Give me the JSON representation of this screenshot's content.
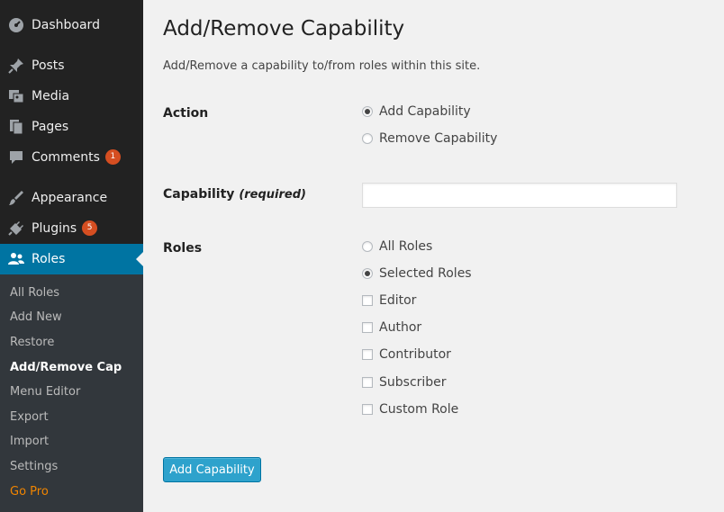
{
  "sidebar": {
    "items": [
      {
        "label": "Dashboard",
        "icon": "dashboard-icon"
      },
      {
        "label": "Posts",
        "icon": "pin-icon"
      },
      {
        "label": "Media",
        "icon": "media-icon"
      },
      {
        "label": "Pages",
        "icon": "pages-icon"
      },
      {
        "label": "Comments",
        "icon": "comment-icon",
        "badge": "1"
      },
      {
        "label": "Appearance",
        "icon": "brush-icon"
      },
      {
        "label": "Plugins",
        "icon": "plug-icon",
        "badge": "5"
      },
      {
        "label": "Roles",
        "icon": "users-icon",
        "active": true
      }
    ],
    "submenu": [
      {
        "label": "All Roles"
      },
      {
        "label": "Add New"
      },
      {
        "label": "Restore"
      },
      {
        "label": "Add/Remove Cap",
        "current": true
      },
      {
        "label": "Menu Editor"
      },
      {
        "label": "Export"
      },
      {
        "label": "Import"
      },
      {
        "label": "Settings"
      },
      {
        "label": "Go Pro",
        "highlight_color": "#f18500"
      }
    ]
  },
  "main": {
    "title": "Add/Remove Capability",
    "description": "Add/Remove a capability to/from roles within this site.",
    "action": {
      "label": "Action",
      "options": [
        {
          "label": "Add Capability",
          "selected": true
        },
        {
          "label": "Remove Capability",
          "selected": false
        }
      ]
    },
    "capability": {
      "label": "Capability",
      "required_note": "(required)",
      "value": "",
      "placeholder": ""
    },
    "roles": {
      "label": "Roles",
      "scope_options": [
        {
          "label": "All Roles",
          "selected": false
        },
        {
          "label": "Selected Roles",
          "selected": true
        }
      ],
      "checkboxes": [
        {
          "label": "Editor",
          "checked": false
        },
        {
          "label": "Author",
          "checked": false
        },
        {
          "label": "Contributor",
          "checked": false
        },
        {
          "label": "Subscriber",
          "checked": false
        },
        {
          "label": "Custom Role",
          "checked": false
        }
      ]
    },
    "submit_label": "Add Capability"
  },
  "colors": {
    "sidebar_bg": "#222222",
    "submenu_bg": "#32373c",
    "active_bg": "#0074a2",
    "badge": "#d54e21",
    "button": "#2ea2cc",
    "go_pro": "#f18500"
  }
}
